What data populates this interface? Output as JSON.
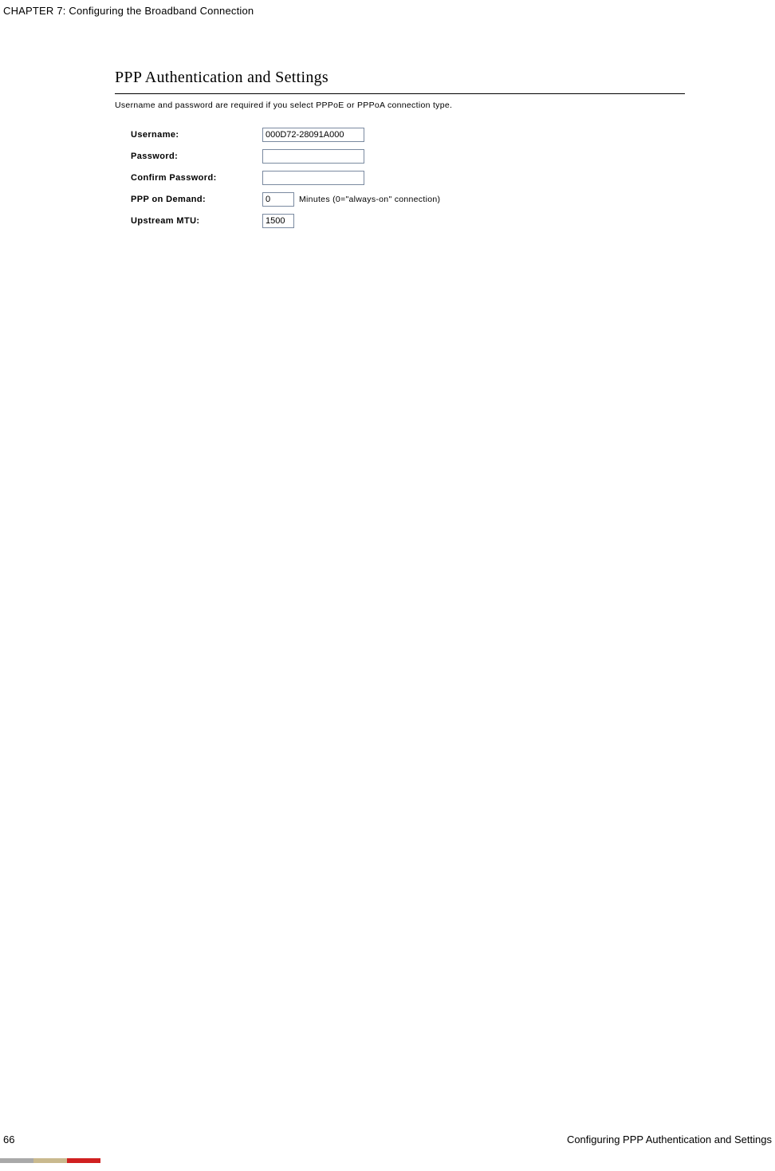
{
  "header": {
    "chapter_line": "CHAPTER 7: Configuring the Broadband Connection"
  },
  "panel": {
    "title": "PPP Authentication and Settings",
    "subtitle": "Username and password are required if you select PPPoE or PPPoA connection type.",
    "fields": {
      "username_label": "Username:",
      "username_value": "000D72-28091A000",
      "password_label": "Password:",
      "password_value": "",
      "confirm_password_label": "Confirm Password:",
      "confirm_password_value": "",
      "ppp_on_demand_label": "PPP on Demand:",
      "ppp_on_demand_value": "0",
      "ppp_on_demand_hint": "Minutes (0=\"always-on\" connection)",
      "upstream_mtu_label": "Upstream MTU:",
      "upstream_mtu_value": "1500"
    }
  },
  "footer": {
    "page_number": "66",
    "section_title": "Configuring PPP Authentication and Settings"
  }
}
